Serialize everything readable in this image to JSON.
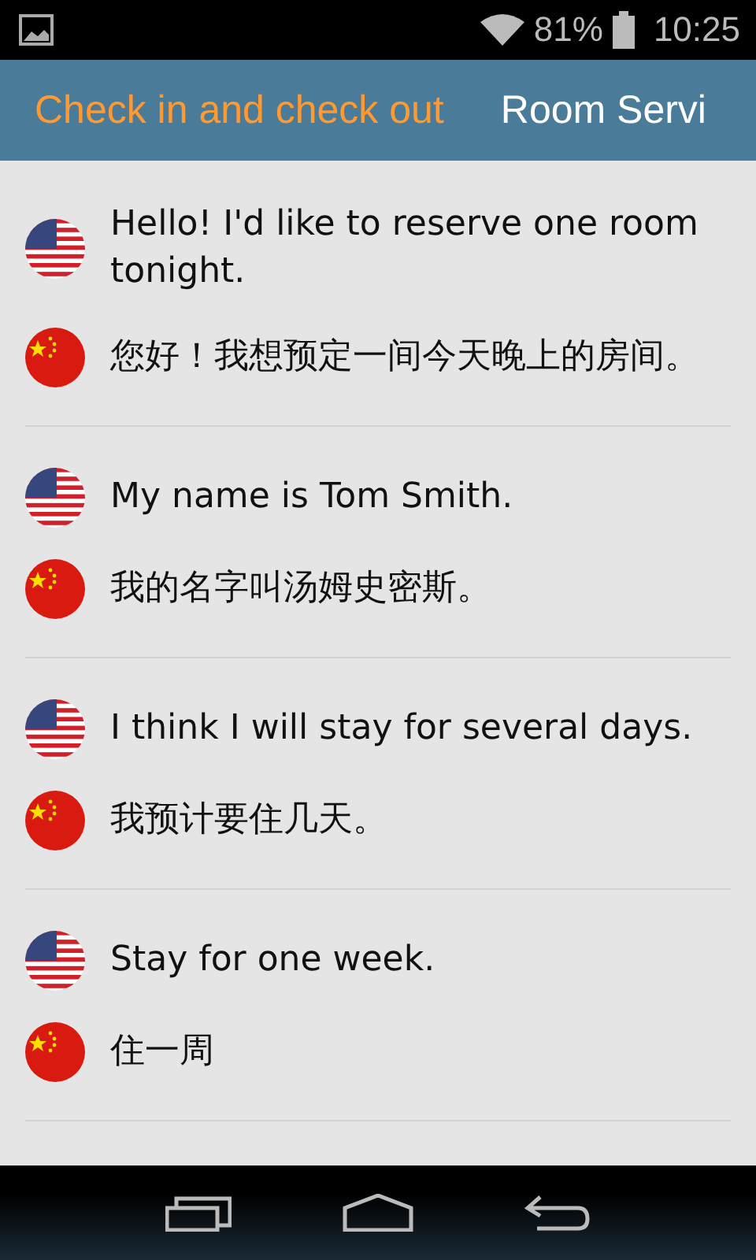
{
  "status_bar": {
    "battery": "81%",
    "time": "10:25"
  },
  "tabs": [
    {
      "label": "Check in and check out",
      "selected": true
    },
    {
      "label": "Room Servi",
      "selected": false
    }
  ],
  "phrases": [
    {
      "lines": [
        {
          "kind": "us",
          "text": "Hello! I'd like to reserve one room tonight."
        },
        {
          "kind": "cn",
          "text": "您好！我想预定一间今天晚上的房间。"
        }
      ]
    },
    {
      "lines": [
        {
          "kind": "us",
          "text": "My name is Tom Smith."
        },
        {
          "kind": "cn",
          "text": "我的名字叫汤姆史密斯。"
        }
      ]
    },
    {
      "lines": [
        {
          "kind": "us",
          "text": "I think I will stay for several days."
        },
        {
          "kind": "cn",
          "text": "我预计要住几天。"
        }
      ]
    },
    {
      "lines": [
        {
          "kind": "us",
          "text": "Stay for one week."
        },
        {
          "kind": "cn",
          "text": "住一周"
        }
      ]
    }
  ]
}
